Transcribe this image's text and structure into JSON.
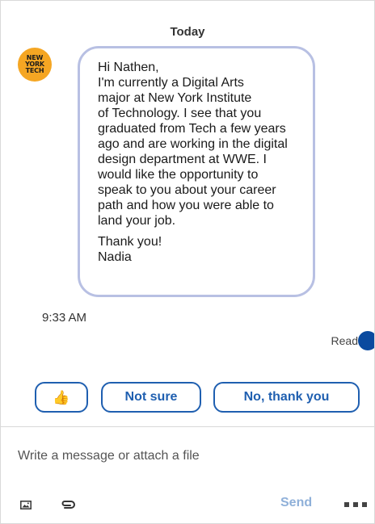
{
  "conversation": {
    "day_label": "Today",
    "sender": {
      "avatar_text": "NEW\nYORK\nTECH",
      "avatar_color": "#f5a623"
    },
    "message": {
      "greeting": "Hi Nathen,",
      "body": "I'm currently a Digital Arts\nmajor at New York Institute\nof Technology. I see that you\ngraduated from Tech a few years\nago and are working in the digital\ndesign department at WWE. I\nwould like the opportunity to\nspeak to you about your career\npath and how you were able to\nland your job.",
      "signoff": "Thank you!\nNadia",
      "bubble_border_color": "#b8c0e3"
    },
    "time": "9:33 AM",
    "read_label": "Read"
  },
  "suggestions": {
    "items": [
      {
        "label": "👍",
        "icon": "thumbs-up-icon"
      },
      {
        "label": "Not sure"
      },
      {
        "label": "No, thank you"
      }
    ],
    "accent_color": "#1f5fb0"
  },
  "composer": {
    "placeholder": "Write a message or attach a file",
    "value": "",
    "send_label": "Send",
    "send_color": "#8fb0d9",
    "icons": [
      "image-icon",
      "attachment-icon",
      "more-icon"
    ]
  }
}
